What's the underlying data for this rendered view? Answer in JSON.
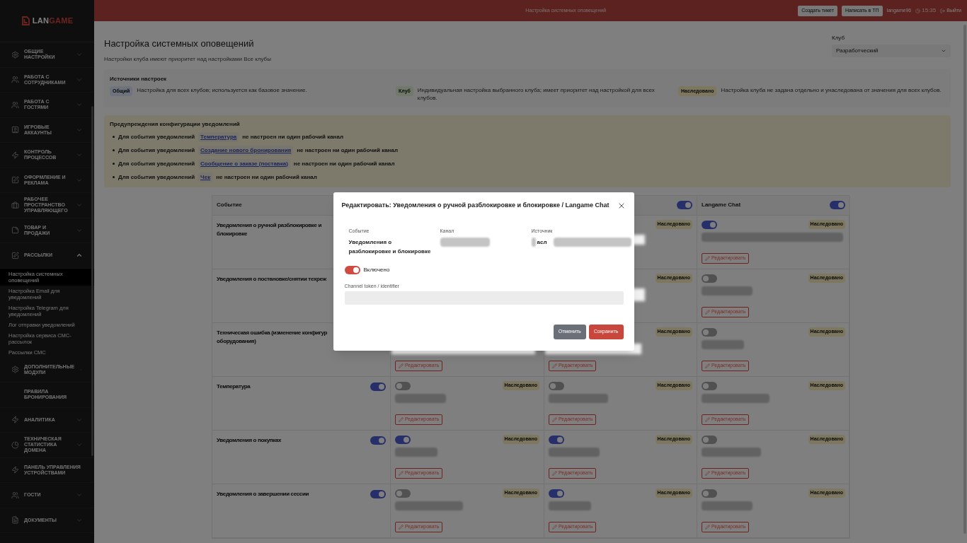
{
  "topbar": {
    "title": "Настройка системных оповещений",
    "buttons": [
      "Создать тикет",
      "Написать в ТП"
    ],
    "user": "langame96",
    "time": "15:35",
    "logout": "Выйти"
  },
  "logo": {
    "first": "LAN",
    "second": "GAME"
  },
  "sidebar": {
    "items": [
      {
        "label": "ОБЩИЕ НАСТРОЙКИ",
        "expanded": false
      },
      {
        "label": "РАБОТА С СОТРУДНИКАМИ",
        "expanded": false
      },
      {
        "label": "РАБОТА С ГОСТЯМИ",
        "expanded": false
      },
      {
        "label": "ИГРОВЫЕ АККАУНТЫ",
        "expanded": false
      },
      {
        "label": "КОНТРОЛЬ ПРОЦЕССОВ",
        "expanded": false
      },
      {
        "label": "ОФОРМЛЕНИЕ И РЕКЛАМА",
        "expanded": false
      },
      {
        "label": "РАБОЧЕЕ ПРОСТРАНСТВО УПРАВЛЯЮЩЕГО",
        "expanded": false
      },
      {
        "label": "ТОВАР И ПРОДАЖИ",
        "expanded": false
      },
      {
        "label": "РАССЫЛКИ",
        "expanded": true,
        "children": [
          {
            "label": "Настройка системных оповещений",
            "selected": true
          },
          {
            "label": "Настройка Email для уведомлений",
            "selected": false
          },
          {
            "label": "Настройка Telegram для уведомлений",
            "selected": false
          },
          {
            "label": "Лог отправки уведомлений",
            "selected": false
          },
          {
            "label": "Настройка сервиса СМС-рассылок",
            "selected": false
          },
          {
            "label": "Рассылки СМС",
            "selected": false
          }
        ]
      },
      {
        "label": "ДОПОЛНИТЕЛЬНЫЕ МОДУЛИ",
        "expanded": false
      },
      {
        "label": "ПРАВИЛА БРОНИРОВАНИЯ"
      },
      {
        "label": "АНАЛИТИКА",
        "expanded": false
      },
      {
        "label": "ТЕХНИЧЕСКАЯ СТАТИСТИКА ДОМЕНА",
        "expanded": false
      },
      {
        "label": "ПАНЕЛЬ УПРАВЛЕНИЯ УСТРОЙСТВАМИ"
      },
      {
        "label": "ГОСТИ",
        "expanded": false
      },
      {
        "label": "ДОКУМЕНТЫ",
        "expanded": false
      }
    ]
  },
  "page": {
    "title": "Настройка системных оповещений",
    "subtitle": "Настройки клуба имеют приоритет над настройками Все клубы",
    "club_label": "Клуб",
    "club_value": "Разработческий"
  },
  "sources": {
    "title": "Источники настроек",
    "items": [
      {
        "badge": "Общий",
        "text": "Настройка для всех клубов; используется как базовое значение."
      },
      {
        "badge": "Клуб",
        "text": "Индивидуальная настройка выбранного клуба; имеет приоритет над настройкой для всех клубов."
      },
      {
        "badge": "Наследовано",
        "text": "Настройка клуба не задана отдельно и унаследована от значения для всех клубов."
      }
    ]
  },
  "warnings": {
    "title": "Предупреждения конфигурации уведомлений",
    "items": [
      {
        "prefix": "Для события уведомлений",
        "link": "Температура",
        "suffix": "не настроен ни один рабочий канал"
      },
      {
        "prefix": "Для события уведомлений",
        "link": "Создание нового бронирования",
        "suffix": "не настроен ни один рабочий канал"
      },
      {
        "prefix": "Для события уведомлений",
        "link": "Сообщение о заказе (поставка)",
        "suffix": "не настроен ни один рабочий канал"
      },
      {
        "prefix": "Для события уведомлений",
        "link": "Чек",
        "suffix": "не настроен ни один рабочий канал"
      }
    ]
  },
  "table": {
    "columns": [
      {
        "label": "Событие"
      },
      {},
      {
        "on": true
      },
      {
        "label": "Langame Chat",
        "on": true
      }
    ],
    "rows": [
      {
        "lines": [
          "Уведомления о ручной разблокировке и",
          "блокировке"
        ],
        "cells": [
          {},
          {
            "badge": "Наследовано"
          },
          {
            "on": true,
            "badge": "Наследовано",
            "edit": "Редактировать"
          }
        ]
      },
      {
        "lines": [
          "Уведомления о постановке/снятии техреж"
        ],
        "cells": [
          {},
          {
            "badge": "Наследовано"
          },
          {
            "on": false,
            "badge": "Наследовано",
            "edit": "Редактировать"
          }
        ]
      },
      {
        "lines": [
          "Техническая ошибка (изменение конфигур",
          "оборудования)"
        ],
        "cells": [
          {
            "edit": "Редактировать"
          },
          {
            "badge": "Наследовано",
            "edit": "Редактировать"
          },
          {
            "on": false,
            "badge": "Наследовано",
            "edit": "Редактировать"
          }
        ]
      },
      {
        "lines": [
          "Температура"
        ],
        "on": true,
        "cells": [
          {
            "on": false,
            "badge": "Наследовано",
            "edit": "Редактировать"
          },
          {
            "on": false,
            "badge": "Наследовано",
            "edit": "Редактировать"
          },
          {
            "on": false,
            "badge": "Наследовано",
            "edit": "Редактировать"
          }
        ]
      },
      {
        "lines": [
          "Уведомления о покупках"
        ],
        "on": true,
        "cells": [
          {
            "on": true,
            "badge": "Наследовано",
            "edit": "Редактировать"
          },
          {
            "on": true,
            "badge": "Наследовано",
            "edit": "Редактировать"
          },
          {
            "on": false,
            "badge": "Наследовано",
            "edit": "Редактировать"
          }
        ]
      },
      {
        "lines": [
          "Уведомления о завершении сессии"
        ],
        "on": true,
        "cells": [
          {
            "on": false,
            "badge": "Наследовано",
            "edit": "Редактировать"
          },
          {
            "on": true,
            "badge": "Наследовано",
            "edit": "Редактировать"
          },
          {
            "on": false,
            "badge": "Наследовано",
            "edit": "Редактировать"
          }
        ]
      }
    ]
  },
  "modal": {
    "title": "Редактировать: Уведомления о ручной разблокировке и блокировке / Langame Chat",
    "fields": [
      {
        "label": "Событие",
        "lines": [
          "Уведомления о",
          "разблокировке и блокировке"
        ]
      },
      {
        "label": "Канал"
      },
      {
        "label": "Источник",
        "lines": [
          "асл"
        ]
      }
    ],
    "enabled": {
      "label": "Включено",
      "on": true
    },
    "token": {
      "label": "Channel token / identifier"
    },
    "buttons": [
      {
        "label": "Отменить",
        "kind": "secondary"
      },
      {
        "label": "Сохранить",
        "kind": "primary"
      }
    ]
  }
}
